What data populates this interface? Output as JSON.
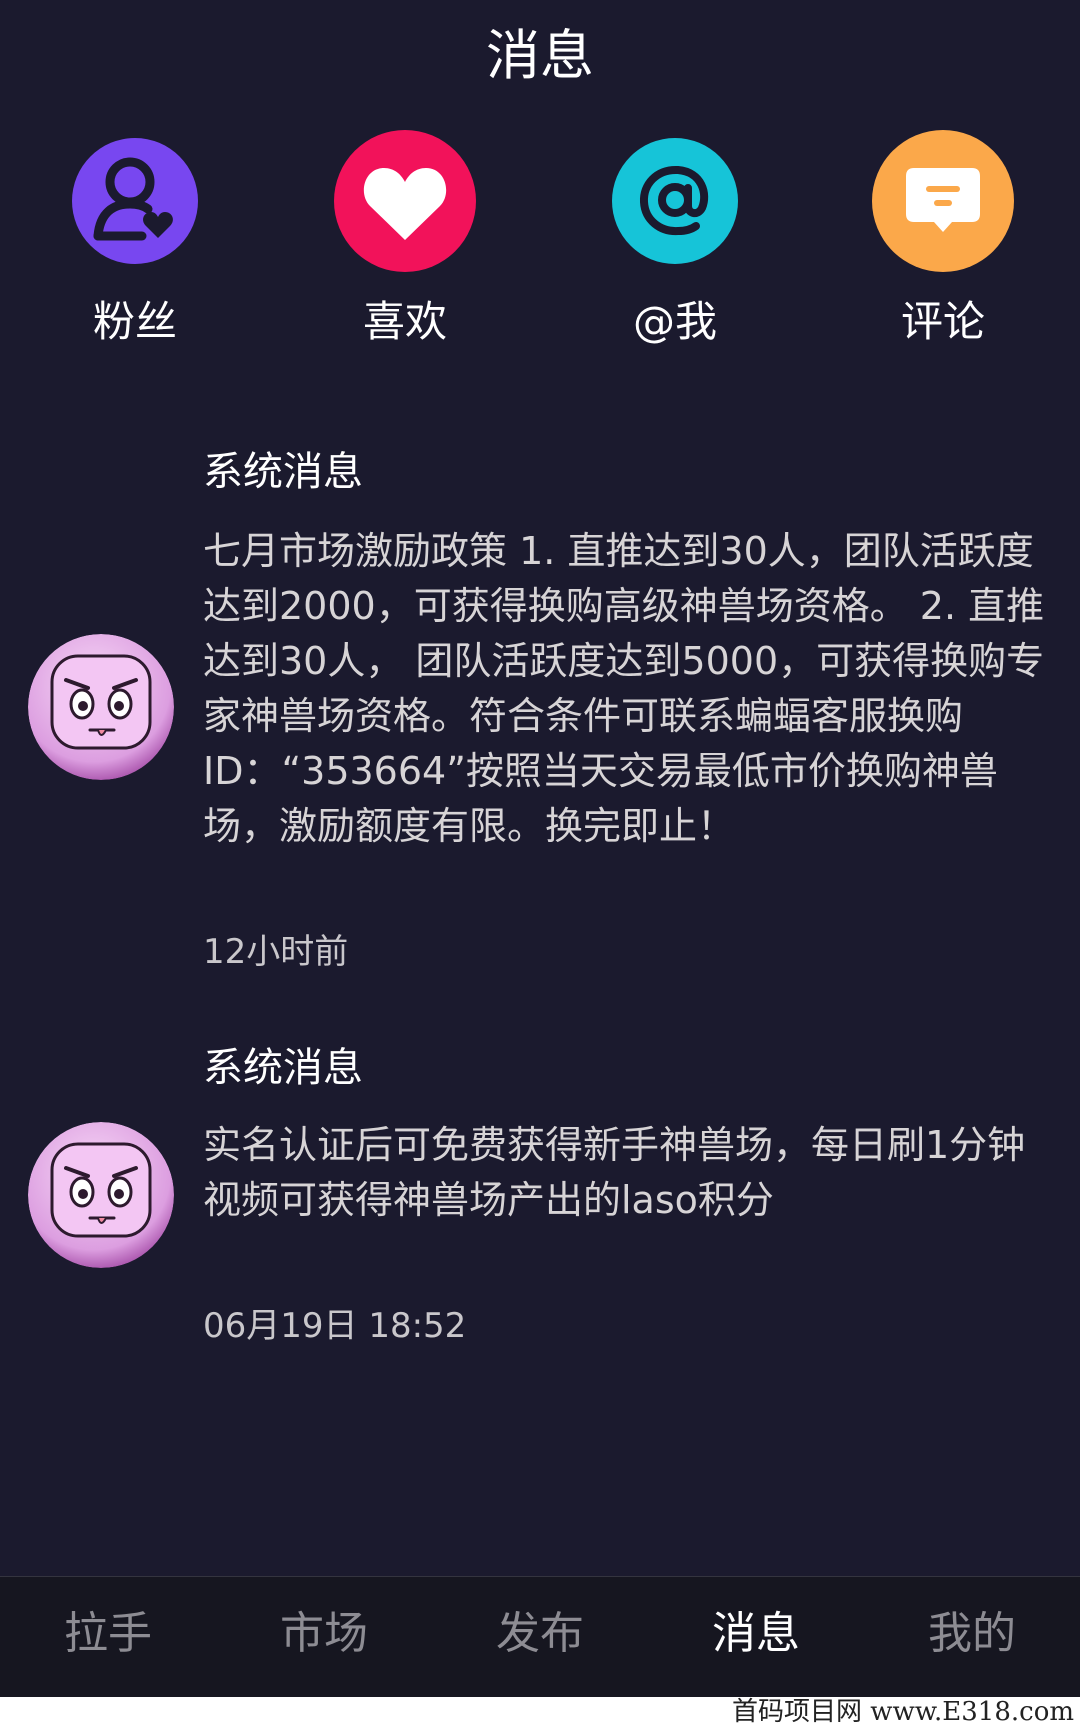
{
  "header": {
    "title": "消息"
  },
  "shortcuts": [
    {
      "label": "粉丝",
      "icon": "follower-heart-icon",
      "color": "#7847f0"
    },
    {
      "label": "喜欢",
      "icon": "heart-icon",
      "color": "#f2125a"
    },
    {
      "label": "@我",
      "icon": "at-sign-icon",
      "color": "#16c4d8"
    },
    {
      "label": "评论",
      "icon": "comment-icon",
      "color": "#fba84a"
    }
  ],
  "messages": [
    {
      "title": "系统消息",
      "body": "七月市场激励政策 1. 直推达到30人，团队活跃度达到2000，可获得换购高级神兽场资格。 2. 直推达到30人， 团队活跃度达到5000，可获得换购专家神兽场资格。符合条件可联系蝙蝠客服换购ID：“353664”按照当天交易最低市价换购神兽场，激励额度有限。换完即止！",
      "time": "12小时前"
    },
    {
      "title": "系统消息",
      "body": "实名认证后可免费获得新手神兽场，每日刷1分钟视频可获得神兽场产出的laso积分",
      "time": "06月19日 18:52"
    }
  ],
  "tabbar": {
    "items": [
      "拉手",
      "市场",
      "发布",
      "消息",
      "我的"
    ],
    "active": "消息"
  },
  "watermark": "首码项目网 www.E318.com"
}
